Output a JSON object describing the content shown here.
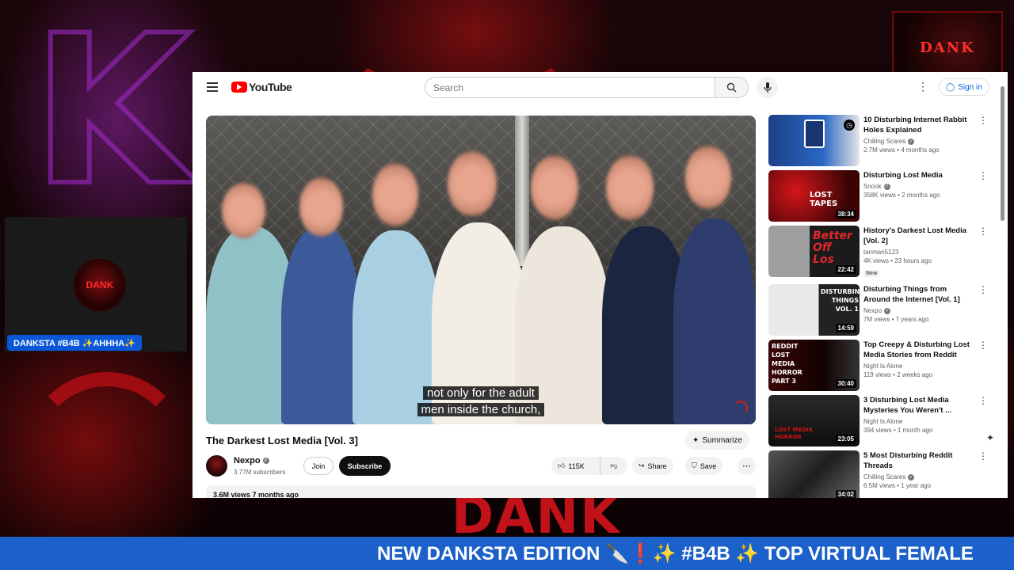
{
  "overlay": {
    "webcam_tag": "DANKSTA #B4B ✨AHHHA✨",
    "ticker": "NEW DANKSTA EDITION 🔪❗✨ #B4B ✨ TOP VIRTUAL FEMALE",
    "bg_text": "DANK",
    "logo_text": "DANK"
  },
  "header": {
    "logo": "YouTube",
    "search_placeholder": "Search",
    "signin": "Sign in"
  },
  "player": {
    "subtitle_line1": "not only for the adult",
    "subtitle_line2": "men inside the church,"
  },
  "video": {
    "title": "The Darkest Lost Media [Vol. 3]",
    "summarize": "Summarize",
    "channel": "Nexpo",
    "subscribers": "3.77M subscribers",
    "join": "Join",
    "subscribe": "Subscribe",
    "likes": "115K",
    "share": "Share",
    "save": "Save",
    "views_date": "3.6M views  7 months ago"
  },
  "recommendations": [
    {
      "title": "10 Disturbing Internet Rabbit Holes Explained",
      "channel": "Chilling Scares",
      "verified": true,
      "meta": "2.7M views • 4 months ago",
      "duration": "",
      "badge": ""
    },
    {
      "title": "Disturbing Lost Media",
      "channel": "Snook",
      "verified": true,
      "meta": "358K views • 2 months ago",
      "duration": "38:34",
      "badge": "",
      "thumb_text": "LOST TAPES"
    },
    {
      "title": "History's Darkest Lost Media [Vol. 2]",
      "channel": "tanman5123",
      "verified": false,
      "meta": "4K views • 23 hours ago",
      "duration": "22:42",
      "badge": "New",
      "thumb_text": "Better Off Los"
    },
    {
      "title": "Disturbing Things from Around the Internet [Vol. 1]",
      "channel": "Nexpo",
      "verified": true,
      "meta": "7M views • 7 years ago",
      "duration": "14:59",
      "badge": "",
      "thumb_text": "DISTURBING THINGS VOL. 1"
    },
    {
      "title": "Top Creepy & Disturbing Lost Media Stories from Reddit (Pa...",
      "channel": "Night Is Alone",
      "verified": false,
      "meta": "119 views • 2 weeks ago",
      "duration": "30:40",
      "badge": "",
      "thumb_text": "REDDIT LOST MEDIA HORROR PART 3"
    },
    {
      "title": "3 Disturbing Lost Media Mysteries You Weren't ...",
      "channel": "Night Is Alone",
      "verified": false,
      "meta": "394 views • 1 month ago",
      "duration": "23:05",
      "badge": "",
      "thumb_text": "LOST MEDIA HORROR"
    },
    {
      "title": "5 Most Disturbing Reddit Threads",
      "channel": "Chilling Scares",
      "verified": true,
      "meta": "6.5M views • 1 year ago",
      "duration": "34:02",
      "badge": ""
    }
  ]
}
